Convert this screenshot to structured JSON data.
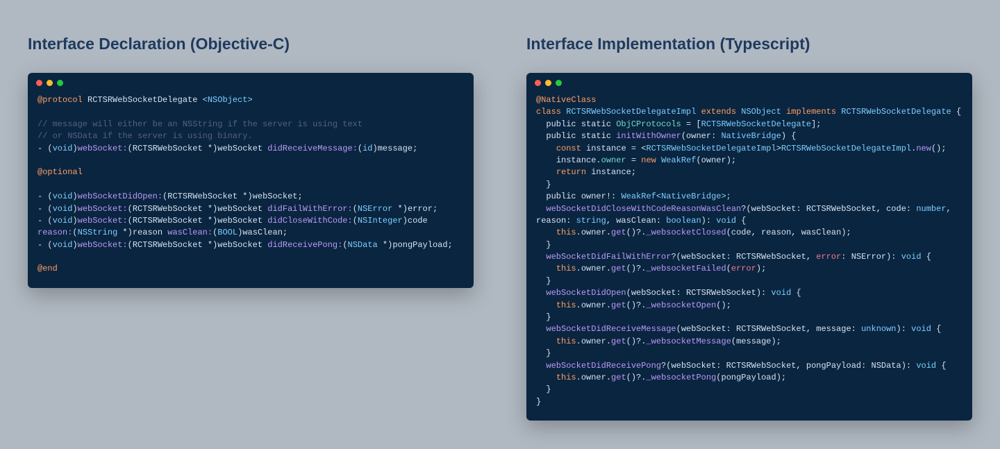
{
  "left": {
    "heading": "Interface Declaration (Objective-C)",
    "code": {
      "protocol_kw": "@protocol",
      "protocol_name": " RCTSRWebSocketDelegate ",
      "proto_open": "<",
      "nsobject": "NSObject",
      "proto_close": ">",
      "comment1": "// message will either be an NSString if the server is using text",
      "comment2": "// or NSData if the server is using binary.",
      "dash1": "- (",
      "void1": "void",
      "rp1": ")",
      "sig1a": "webSocket:",
      "sig1b": "(RCTSRWebSocket *)",
      "sig1c": "webSocket ",
      "sig1d": "didReceiveMessage:",
      "sig1e": "(",
      "sig1e_type": "id",
      "sig1f": ")",
      "sig1g": "message;",
      "optional": "@optional",
      "dash2": "- (",
      "void2": "void",
      "rp2": ")",
      "sig2a": "webSocketDidOpen:",
      "sig2b": "(RCTSRWebSocket *)",
      "sig2c": "webSocket;",
      "dash3": "- (",
      "void3": "void",
      "rp3": ")",
      "sig3a": "webSocket:",
      "sig3b": "(RCTSRWebSocket *)",
      "sig3c": "webSocket ",
      "sig3d": "didFailWithError:",
      "sig3e": "(",
      "sig3e_type": "NSError",
      "sig3f": " *)",
      "sig3g": "error;",
      "dash4": "- (",
      "void4": "void",
      "rp4": ")",
      "sig4a": "webSocket:",
      "sig4b": "(RCTSRWebSocket *)",
      "sig4c": "webSocket ",
      "sig4d": "didCloseWithCode:",
      "sig4e": "(",
      "sig4e_type": "NSInteger",
      "sig4f": ")",
      "sig4g": "code ",
      "sig4h": "reason:",
      "sig4i": "(",
      "sig4i_type": "NSString",
      "sig4j": " *)",
      "sig4k": "reason ",
      "sig4l": "wasClean:",
      "sig4m": "(",
      "sig4m_type": "BOOL",
      "sig4n": ")",
      "sig4o": "wasClean;",
      "dash5": "- (",
      "void5": "void",
      "rp5": ")",
      "sig5a": "webSocket:",
      "sig5b": "(RCTSRWebSocket *)",
      "sig5c": "webSocket ",
      "sig5d": "didReceivePong:",
      "sig5e": "(",
      "sig5e_type": "NSData",
      "sig5f": " *)",
      "sig5g": "pongPayload;",
      "end": "@end"
    }
  },
  "right": {
    "heading": "Interface Implementation (Typescript)",
    "code": {
      "decorator": "@NativeClass",
      "class_kw": "class",
      "class_name": " RCTSRWebSocketDelegateImpl ",
      "extends": "extends",
      "super": " NSObject ",
      "implements": "implements",
      "iface": " RCTSRWebSocketDelegate ",
      "ob": "{",
      "l1a": "  public static ",
      "l1b": "ObjCProtocols",
      "l1c": " = [",
      "l1d": "RCTSRWebSocketDelegate",
      "l1e": "];",
      "l2a": "  public static ",
      "l2b": "initWithOwner",
      "l2c": "(owner: ",
      "l2d": "NativeBridge",
      "l2e": ") {",
      "l3a": "    ",
      "l3b": "const",
      "l3c": " instance = <",
      "l3d": "RCTSRWebSocketDelegateImpl",
      "l3e": ">",
      "l3f": "RCTSRWebSocketDelegateImpl",
      "l3g": ".",
      "l3h": "new",
      "l3i": "();",
      "l4a": "    instance",
      "l4b": ".",
      "l4c": "owner",
      "l4d": " = ",
      "l4e": "new",
      "l4f": " ",
      "l4g": "WeakRef",
      "l4h": "(owner);",
      "l5a": "    ",
      "l5b": "return",
      "l5c": " instance;",
      "l6": "  }",
      "l7a": "  public owner!: ",
      "l7b": "WeakRef",
      "l7c": "<",
      "l7d": "NativeBridge",
      "l7e": ">;",
      "l8a": "  ",
      "l8b": "webSocketDidCloseWithCodeReasonWasClean",
      "l8c": "?(webSocket: RCTSRWebSocket, code: ",
      "l8d": "number",
      "l8e": ", reason: ",
      "l8f": "string",
      "l8g": ", wasClean: ",
      "l8h": "boolean",
      "l8i": "): ",
      "l8j": "void",
      "l8k": " {",
      "l9a": "    ",
      "l9b": "this",
      "l9c": ".owner.",
      "l9d": "get",
      "l9e": "()?.",
      "l9f": "_websocketClosed",
      "l9g": "(code, reason, wasClean);",
      "l10": "  }",
      "l11a": "  ",
      "l11b": "webSocketDidFailWithError",
      "l11c": "?(webSocket: RCTSRWebSocket, ",
      "l11d": "error",
      "l11e": ": NSError): ",
      "l11f": "void",
      "l11g": " {",
      "l12a": "    ",
      "l12b": "this",
      "l12c": ".owner.",
      "l12d": "get",
      "l12e": "()?.",
      "l12f": "_websocketFailed",
      "l12g": "(",
      "l12h": "error",
      "l12i": ");",
      "l13": "  }",
      "l14a": "  ",
      "l14b": "webSocketDidOpen",
      "l14c": "(webSocket: RCTSRWebSocket): ",
      "l14d": "void",
      "l14e": " {",
      "l15a": "    ",
      "l15b": "this",
      "l15c": ".owner.",
      "l15d": "get",
      "l15e": "()?.",
      "l15f": "_websocketOpen",
      "l15g": "();",
      "l16": "  }",
      "l17a": "  ",
      "l17b": "webSocketDidReceiveMessage",
      "l17c": "(webSocket: RCTSRWebSocket, message: ",
      "l17d": "unknown",
      "l17e": "): ",
      "l17f": "void",
      "l17g": " {",
      "l18a": "    ",
      "l18b": "this",
      "l18c": ".owner.",
      "l18d": "get",
      "l18e": "()?.",
      "l18f": "_websocketMessage",
      "l18g": "(message);",
      "l19": "  }",
      "l20a": "  ",
      "l20b": "webSocketDidReceivePong",
      "l20c": "?(webSocket: RCTSRWebSocket, pongPayload: NSData): ",
      "l20d": "void",
      "l20e": " {",
      "l21a": "    ",
      "l21b": "this",
      "l21c": ".owner.",
      "l21d": "get",
      "l21e": "()?.",
      "l21f": "_websocketPong",
      "l21g": "(pongPayload);",
      "l22": "  }",
      "cb": "}"
    }
  }
}
